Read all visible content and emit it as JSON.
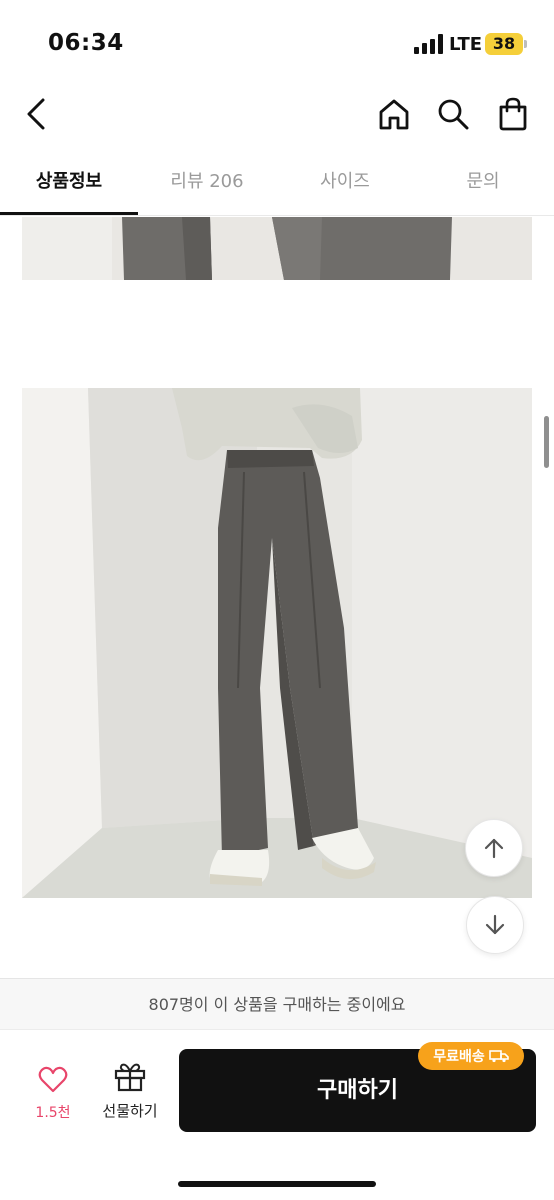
{
  "status_bar": {
    "time": "06:34",
    "network": "LTE",
    "battery": "38"
  },
  "top_nav": {
    "back_icon": "chevron-left-icon",
    "home_icon": "home-icon",
    "search_icon": "search-icon",
    "bag_icon": "shopping-bag-icon"
  },
  "tabs": [
    {
      "label": "상품정보",
      "active": true
    },
    {
      "label": "리뷰 206",
      "active": false
    },
    {
      "label": "사이즈",
      "active": false
    },
    {
      "label": "문의",
      "active": false
    }
  ],
  "buyers_text": "807명이 이 상품을 구매하는 중이에요",
  "bottom_bar": {
    "like_count": "1.5천",
    "gift_label": "선물하기",
    "buy_label": "구매하기",
    "shipping_badge": "무료배송"
  },
  "colors": {
    "accent_pink": "#e8456a",
    "badge_orange": "#f7a21b",
    "buy_button": "#111111",
    "battery": "#f5cf3a"
  }
}
